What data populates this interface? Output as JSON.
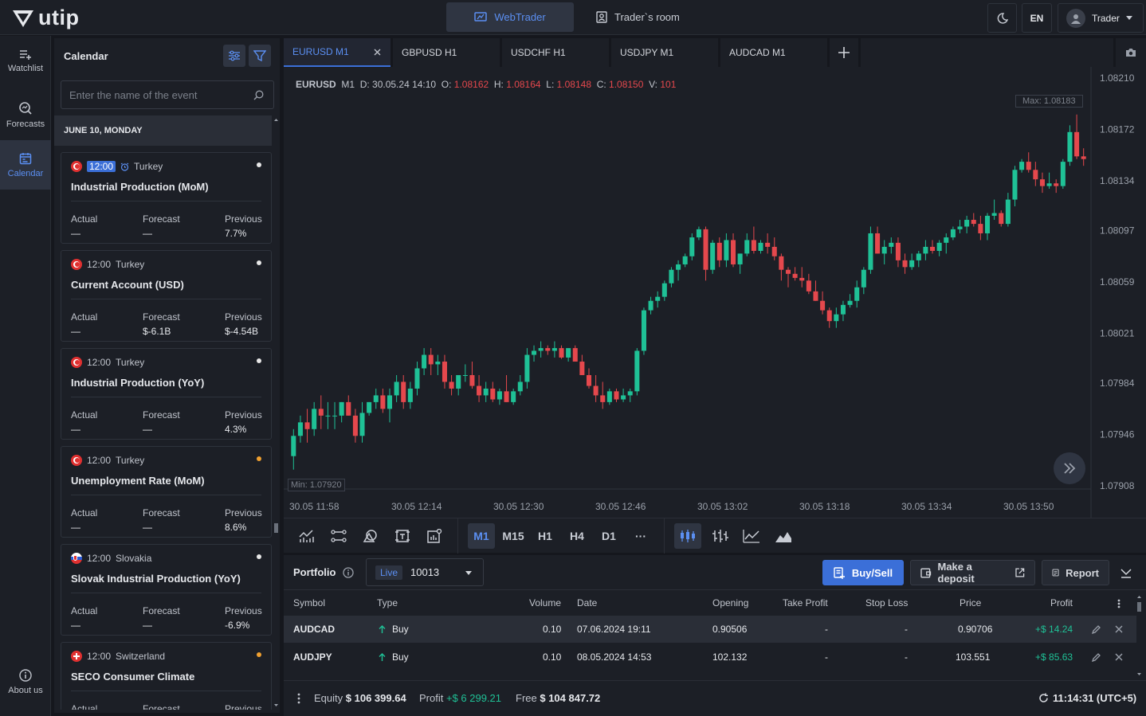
{
  "app": {
    "logo": "utip"
  },
  "topnav": {
    "webtrader": "WebTrader",
    "traders_room": "Trader`s room",
    "lang": "EN",
    "user": "Trader"
  },
  "sidebar": {
    "items": [
      {
        "label": "Watchlist"
      },
      {
        "label": "Forecasts"
      },
      {
        "label": "Calendar"
      }
    ],
    "about": "About us"
  },
  "calendar": {
    "title": "Calendar",
    "search_placeholder": "Enter the name of the event",
    "day": "JUNE 10, MONDAY",
    "col_actual": "Actual",
    "col_forecast": "Forecast",
    "col_previous": "Previous",
    "events": [
      {
        "time": "12:00",
        "country": "Turkey",
        "name": "Industrial Production (MoM)",
        "actual": "—",
        "forecast": "—",
        "previous": "7.7%",
        "dot": "#e8e8e8"
      },
      {
        "time": "12:00",
        "country": "Turkey",
        "name": "Current Account (USD)",
        "actual": "—",
        "forecast": "$-6.1B",
        "previous": "$-4.54B",
        "dot": "#e8e8e8"
      },
      {
        "time": "12:00",
        "country": "Turkey",
        "name": "Industrial Production (YoY)",
        "actual": "—",
        "forecast": "—",
        "previous": "4.3%",
        "dot": "#e8e8e8"
      },
      {
        "time": "12:00",
        "country": "Turkey",
        "name": "Unemployment Rate (MoM)",
        "actual": "—",
        "forecast": "—",
        "previous": "8.6%",
        "dot": "#f0a030"
      },
      {
        "time": "12:00",
        "country": "Slovakia",
        "name": "Slovak Industrial Production (YoY)",
        "actual": "—",
        "forecast": "—",
        "previous": "-6.9%",
        "dot": "#e8e8e8"
      },
      {
        "time": "12:00",
        "country": "Switzerland",
        "name": "SECO Consumer Climate",
        "actual": "",
        "forecast": "",
        "previous": "",
        "dot": "#f0a030"
      }
    ]
  },
  "tabs": [
    {
      "label": "EURUSD M1"
    },
    {
      "label": "GBPUSD H1"
    },
    {
      "label": "USDCHF H1"
    },
    {
      "label": "USDJPY M1"
    },
    {
      "label": "AUDCAD M1"
    }
  ],
  "chart_info": {
    "symbol": "EURUSD",
    "tf": "M1",
    "d_label": "D:",
    "date": "30.05.24 14:10",
    "o_label": "O:",
    "open": "1.08162",
    "h_label": "H:",
    "high": "1.08164",
    "l_label": "L:",
    "low": "1.08148",
    "c_label": "C:",
    "close": "1.08150",
    "v_label": "V:",
    "volume": "101",
    "max_label": "Max: 1.08183",
    "min_label": "Min: 1.07920"
  },
  "chart_data": {
    "type": "candlestick",
    "y_ticks": [
      "1.08210",
      "1.08172",
      "1.08134",
      "1.08097",
      "1.08059",
      "1.08021",
      "1.07984",
      "1.07946",
      "1.07908"
    ],
    "x_ticks": [
      "30.05 11:58",
      "30.05 12:14",
      "30.05 12:30",
      "30.05 12:46",
      "30.05 13:02",
      "30.05 13:18",
      "30.05 13:34",
      "30.05 13:50"
    ],
    "ylim": [
      1.07908,
      1.0821
    ],
    "candles_ohlc": [
      [
        1.0793,
        1.0795,
        1.0792,
        1.07945
      ],
      [
        1.07945,
        1.0796,
        1.0794,
        1.07955
      ],
      [
        1.07955,
        1.07965,
        1.0794,
        1.0795
      ],
      [
        1.0795,
        1.0797,
        1.07945,
        1.07965
      ],
      [
        1.07965,
        1.07975,
        1.0795,
        1.0796
      ],
      [
        1.0796,
        1.0797,
        1.0795,
        1.0796
      ],
      [
        1.0796,
        1.0797,
        1.0795,
        1.0796
      ],
      [
        1.0796,
        1.0797,
        1.07955,
        1.0797
      ],
      [
        1.0797,
        1.07975,
        1.0796,
        1.0796
      ],
      [
        1.0796,
        1.07965,
        1.0794,
        1.07945
      ],
      [
        1.07945,
        1.0797,
        1.0794,
        1.07962
      ],
      [
        1.07962,
        1.0797,
        1.0796,
        1.0797
      ],
      [
        1.0797,
        1.0798,
        1.07965,
        1.07975
      ],
      [
        1.07975,
        1.0798,
        1.07962,
        1.07965
      ],
      [
        1.07965,
        1.0798,
        1.07955,
        1.07975
      ],
      [
        1.07975,
        1.0799,
        1.0797,
        1.07985
      ],
      [
        1.07985,
        1.0799,
        1.07965,
        1.0797
      ],
      [
        1.0797,
        1.07985,
        1.07965,
        1.0798
      ],
      [
        1.0798,
        1.08,
        1.07975,
        1.07995
      ],
      [
        1.07995,
        1.0801,
        1.0799,
        1.08005
      ],
      [
        1.08005,
        1.0801,
        1.0799,
        1.07998
      ],
      [
        1.07998,
        1.08005,
        1.0799,
        1.08
      ],
      [
        1.08,
        1.08005,
        1.0798,
        1.07985
      ],
      [
        1.07985,
        1.0799,
        1.07975,
        1.0798
      ],
      [
        1.0798,
        1.0799,
        1.07975,
        1.0799
      ],
      [
        1.0799,
        1.07998,
        1.07985,
        1.0799
      ],
      [
        1.0799,
        1.08,
        1.0798,
        1.07982
      ],
      [
        1.07982,
        1.0799,
        1.0797,
        1.07975
      ],
      [
        1.07975,
        1.07985,
        1.0797,
        1.0798
      ],
      [
        1.0798,
        1.07985,
        1.0797,
        1.07972
      ],
      [
        1.07972,
        1.0798,
        1.07968,
        1.07978
      ],
      [
        1.07978,
        1.0799,
        1.0797,
        1.0797
      ],
      [
        1.0797,
        1.0798,
        1.07968,
        1.07978
      ],
      [
        1.07978,
        1.0799,
        1.07975,
        1.07985
      ],
      [
        1.07985,
        1.0801,
        1.0798,
        1.08005
      ],
      [
        1.08005,
        1.08012,
        1.08,
        1.08008
      ],
      [
        1.08008,
        1.08015,
        1.08003,
        1.0801
      ],
      [
        1.0801,
        1.08012,
        1.08005,
        1.08008
      ],
      [
        1.08008,
        1.08015,
        1.08003,
        1.0801
      ],
      [
        1.0801,
        1.08012,
        1.08002,
        1.08003
      ],
      [
        1.08003,
        1.0801,
        1.08,
        1.0801
      ],
      [
        1.0801,
        1.08012,
        1.08,
        1.08
      ],
      [
        1.08,
        1.08005,
        1.0799,
        1.0799
      ],
      [
        1.0799,
        1.07995,
        1.0798,
        1.07982
      ],
      [
        1.07982,
        1.0799,
        1.0797,
        1.07975
      ],
      [
        1.07975,
        1.07985,
        1.07965,
        1.0797
      ],
      [
        1.0797,
        1.0798,
        1.07968,
        1.07978
      ],
      [
        1.07978,
        1.0798,
        1.0797,
        1.07972
      ],
      [
        1.07972,
        1.0798,
        1.0797,
        1.07975
      ],
      [
        1.07975,
        1.0798,
        1.0797,
        1.07978
      ],
      [
        1.07978,
        1.0801,
        1.07975,
        1.08008
      ],
      [
        1.08008,
        1.0804,
        1.08005,
        1.08038
      ],
      [
        1.08038,
        1.08048,
        1.08035,
        1.08045
      ],
      [
        1.08045,
        1.08052,
        1.0804,
        1.08048
      ],
      [
        1.08048,
        1.0806,
        1.08045,
        1.08058
      ],
      [
        1.08058,
        1.0807,
        1.08055,
        1.08068
      ],
      [
        1.08068,
        1.08075,
        1.0806,
        1.08072
      ],
      [
        1.08072,
        1.0808,
        1.0807,
        1.08078
      ],
      [
        1.08078,
        1.08095,
        1.08075,
        1.08092
      ],
      [
        1.08092,
        1.081,
        1.0809,
        1.08098
      ],
      [
        1.08098,
        1.081,
        1.0806,
        1.08068
      ],
      [
        1.08068,
        1.0809,
        1.08065,
        1.08088
      ],
      [
        1.08088,
        1.08092,
        1.0807,
        1.08075
      ],
      [
        1.08075,
        1.08095,
        1.0807,
        1.0809
      ],
      [
        1.0809,
        1.08095,
        1.0807,
        1.08072
      ],
      [
        1.08072,
        1.0808,
        1.08065,
        1.0808
      ],
      [
        1.0808,
        1.08095,
        1.08078,
        1.0809
      ],
      [
        1.0809,
        1.081,
        1.0808,
        1.08082
      ],
      [
        1.08082,
        1.0809,
        1.0808,
        1.08088
      ],
      [
        1.08088,
        1.08095,
        1.0808,
        1.08085
      ],
      [
        1.08085,
        1.08092,
        1.08075,
        1.08078
      ],
      [
        1.08078,
        1.0808,
        1.0806,
        1.08068
      ],
      [
        1.08068,
        1.0807,
        1.08055,
        1.08065
      ],
      [
        1.08065,
        1.0807,
        1.0806,
        1.08062
      ],
      [
        1.08062,
        1.0807,
        1.08055,
        1.0806
      ],
      [
        1.0806,
        1.08065,
        1.0805,
        1.08052
      ],
      [
        1.08052,
        1.0806,
        1.08045,
        1.08045
      ],
      [
        1.08045,
        1.08052,
        1.08035,
        1.08038
      ],
      [
        1.08038,
        1.0804,
        1.08025,
        1.0803
      ],
      [
        1.0803,
        1.0804,
        1.08025,
        1.08035
      ],
      [
        1.08035,
        1.08045,
        1.0803,
        1.08042
      ],
      [
        1.08042,
        1.0805,
        1.0804,
        1.08045
      ],
      [
        1.08045,
        1.0806,
        1.0804,
        1.08055
      ],
      [
        1.08055,
        1.0807,
        1.0805,
        1.08068
      ],
      [
        1.08068,
        1.081,
        1.08065,
        1.08095
      ],
      [
        1.08095,
        1.081,
        1.0808,
        1.0808
      ],
      [
        1.0808,
        1.0809,
        1.08072,
        1.08085
      ],
      [
        1.08085,
        1.08092,
        1.0808,
        1.08088
      ],
      [
        1.08088,
        1.08092,
        1.0807,
        1.08075
      ],
      [
        1.08075,
        1.0808,
        1.08065,
        1.0807
      ],
      [
        1.0807,
        1.0808,
        1.08068,
        1.08075
      ],
      [
        1.08075,
        1.08082,
        1.0807,
        1.0808
      ],
      [
        1.0808,
        1.0809,
        1.08075,
        1.08085
      ],
      [
        1.08085,
        1.0809,
        1.0808,
        1.08082
      ],
      [
        1.08082,
        1.0809,
        1.08078,
        1.08088
      ],
      [
        1.08088,
        1.08095,
        1.0808,
        1.08092
      ],
      [
        1.08092,
        1.081,
        1.0809,
        1.08098
      ],
      [
        1.08098,
        1.08105,
        1.08095,
        1.081
      ],
      [
        1.081,
        1.08108,
        1.08095,
        1.08105
      ],
      [
        1.08105,
        1.0811,
        1.081,
        1.08102
      ],
      [
        1.08102,
        1.08108,
        1.0809,
        1.08095
      ],
      [
        1.08095,
        1.0811,
        1.0809,
        1.08108
      ],
      [
        1.08108,
        1.0812,
        1.08105,
        1.0811
      ],
      [
        1.0811,
        1.08112,
        1.081,
        1.08102
      ],
      [
        1.08102,
        1.08125,
        1.081,
        1.0812
      ],
      [
        1.0812,
        1.08145,
        1.08115,
        1.08142
      ],
      [
        1.08142,
        1.0815,
        1.0814,
        1.08148
      ],
      [
        1.08148,
        1.08155,
        1.0814,
        1.08142
      ],
      [
        1.08142,
        1.08148,
        1.0813,
        1.08135
      ],
      [
        1.08135,
        1.0814,
        1.08125,
        1.0813
      ],
      [
        1.0813,
        1.0814,
        1.08128,
        1.08132
      ],
      [
        1.08132,
        1.08135,
        1.08125,
        1.0813
      ],
      [
        1.0813,
        1.0815,
        1.08128,
        1.08148
      ],
      [
        1.08148,
        1.08175,
        1.08145,
        1.0817
      ],
      [
        1.0817,
        1.08183,
        1.0815,
        1.08152
      ],
      [
        1.08152,
        1.08158,
        1.08145,
        1.0815
      ]
    ]
  },
  "toolbar": {
    "timeframes": [
      "M1",
      "M15",
      "H1",
      "H4",
      "D1"
    ],
    "more": "···"
  },
  "portfolio": {
    "title": "Portfolio",
    "live": "Live",
    "account": "10013",
    "buy_sell": "Buy/Sell",
    "deposit": "Make a deposit",
    "report": "Report",
    "columns": [
      "Symbol",
      "Type",
      "Volume",
      "Date",
      "Opening",
      "Take Profit",
      "Stop Loss",
      "Price",
      "Profit"
    ],
    "rows": [
      {
        "symbol": "AUDCAD",
        "type": "Buy",
        "volume": "0.10",
        "date": "07.06.2024 19:11",
        "opening": "0.90506",
        "tp": "-",
        "sl": "-",
        "price": "0.90706",
        "profit": "+$ 14.24"
      },
      {
        "symbol": "AUDJPY",
        "type": "Buy",
        "volume": "0.10",
        "date": "08.05.2024 14:53",
        "opening": "102.132",
        "tp": "-",
        "sl": "-",
        "price": "103.551",
        "profit": "+$ 85.63"
      }
    ],
    "equity_label": "Equity",
    "equity": "$ 106 399.64",
    "profit_label": "Profit",
    "profit": "+$ 6 299.21",
    "free_label": "Free",
    "free": "$ 104 847.72",
    "clock": "11:14:31 (UTC+5)"
  },
  "colors": {
    "accent": "#3b6fd8",
    "up": "#1fc196",
    "down": "#e5484d",
    "bg": "#1c1f26"
  }
}
